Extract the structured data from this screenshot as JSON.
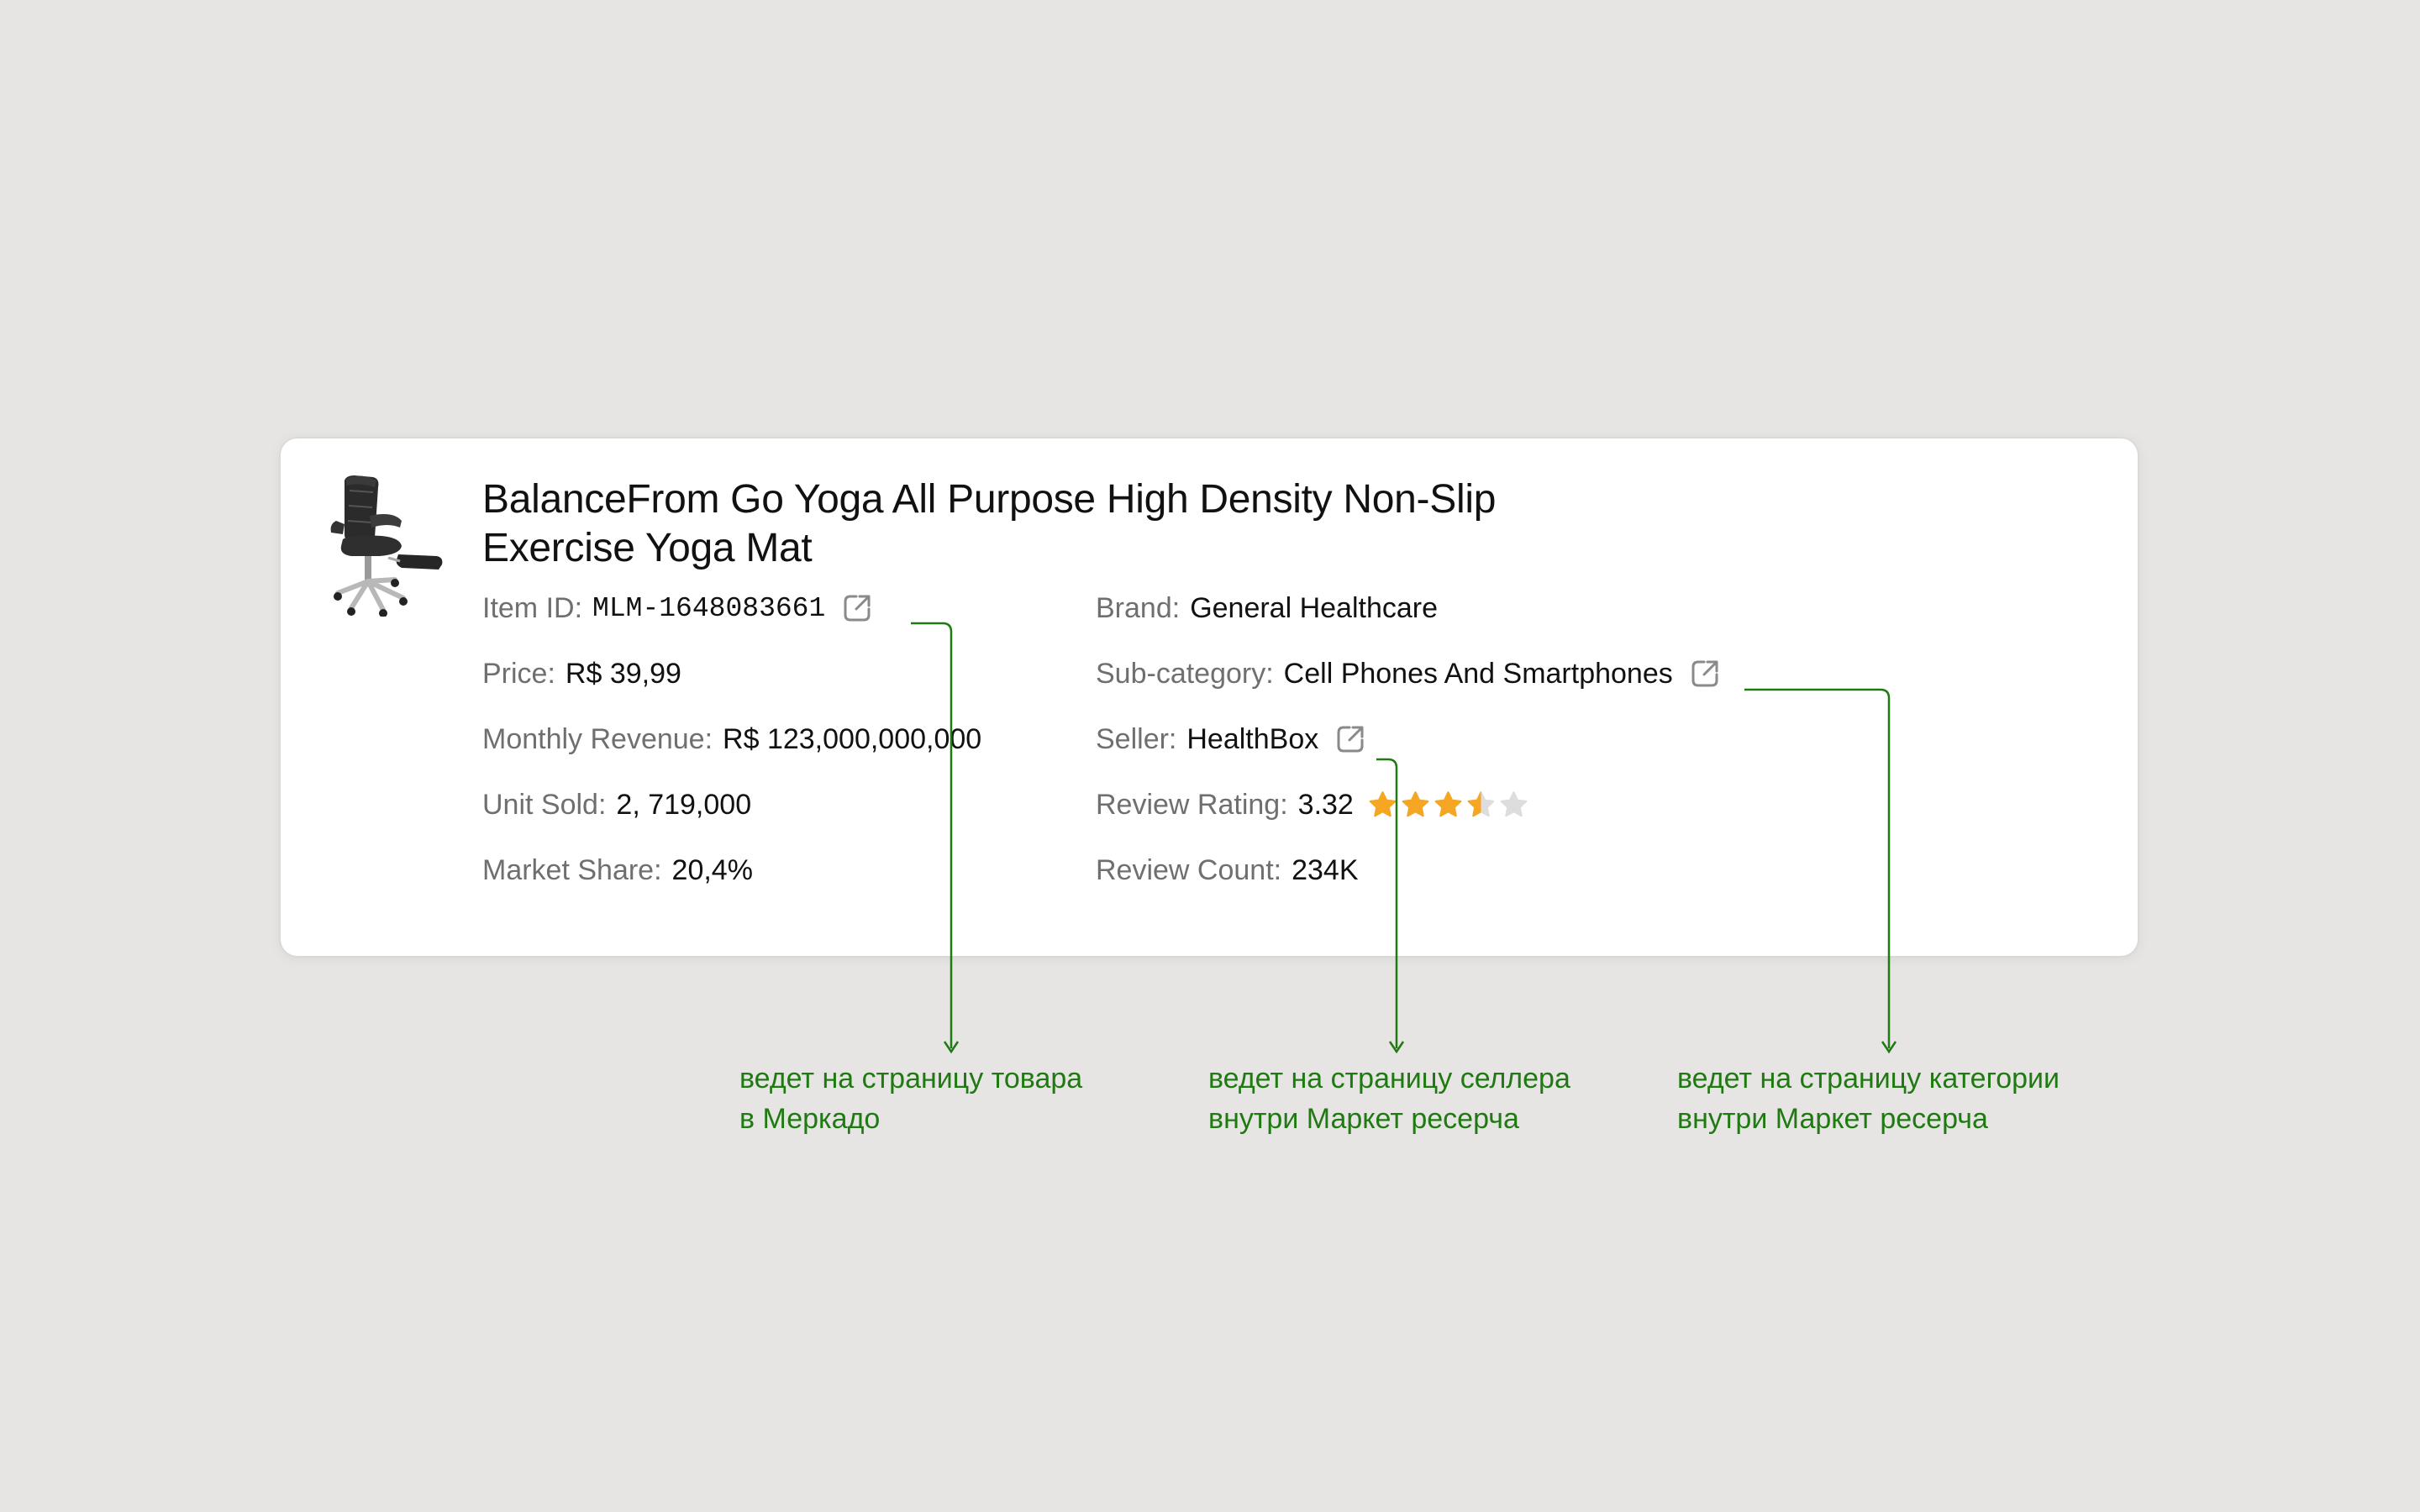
{
  "product": {
    "title": "BalanceFrom Go Yoga All Purpose High Density Non-Slip Exercise Yoga Mat",
    "image_icon": "office-chair-image"
  },
  "fields": {
    "item_id": {
      "label": "Item ID:",
      "value": "MLM-1648083661"
    },
    "price": {
      "label": "Price:",
      "value": "R$ 39,99"
    },
    "monthly_revenue": {
      "label": "Monthly Revenue:",
      "value": "R$ 123,000,000,000"
    },
    "unit_sold": {
      "label": "Unit Sold:",
      "value": "2, 719,000"
    },
    "market_share": {
      "label": "Market Share:",
      "value": "20,4%"
    },
    "brand": {
      "label": "Brand:",
      "value": "General Healthcare"
    },
    "sub_category": {
      "label": "Sub-category:",
      "value": "Cell Phones And Smartphones"
    },
    "seller": {
      "label": "Seller:",
      "value": "HealthBox"
    },
    "review_rating": {
      "label": "Review Rating:",
      "value": "3.32",
      "stars": 3.5,
      "max_stars": 5
    },
    "review_count": {
      "label": "Review Count:",
      "value": "234K"
    }
  },
  "icons": {
    "external_link": "external-link-icon",
    "star": "star-icon"
  },
  "annotations": {
    "item_link": [
      "ведет на страницу товара",
      "в Меркадо"
    ],
    "seller_link": [
      "ведет на страницу селлера",
      "внутри Маркет ресерча"
    ],
    "category_link": [
      "ведет на страницу категории",
      "внутри Маркет ресерча"
    ]
  },
  "colors": {
    "background": "#e6e5e3",
    "card": "#ffffff",
    "label": "#6f6f6f",
    "value": "#111111",
    "annotation": "#1f7a12",
    "star_filled": "#f5a623",
    "star_empty": "#dddddd"
  }
}
